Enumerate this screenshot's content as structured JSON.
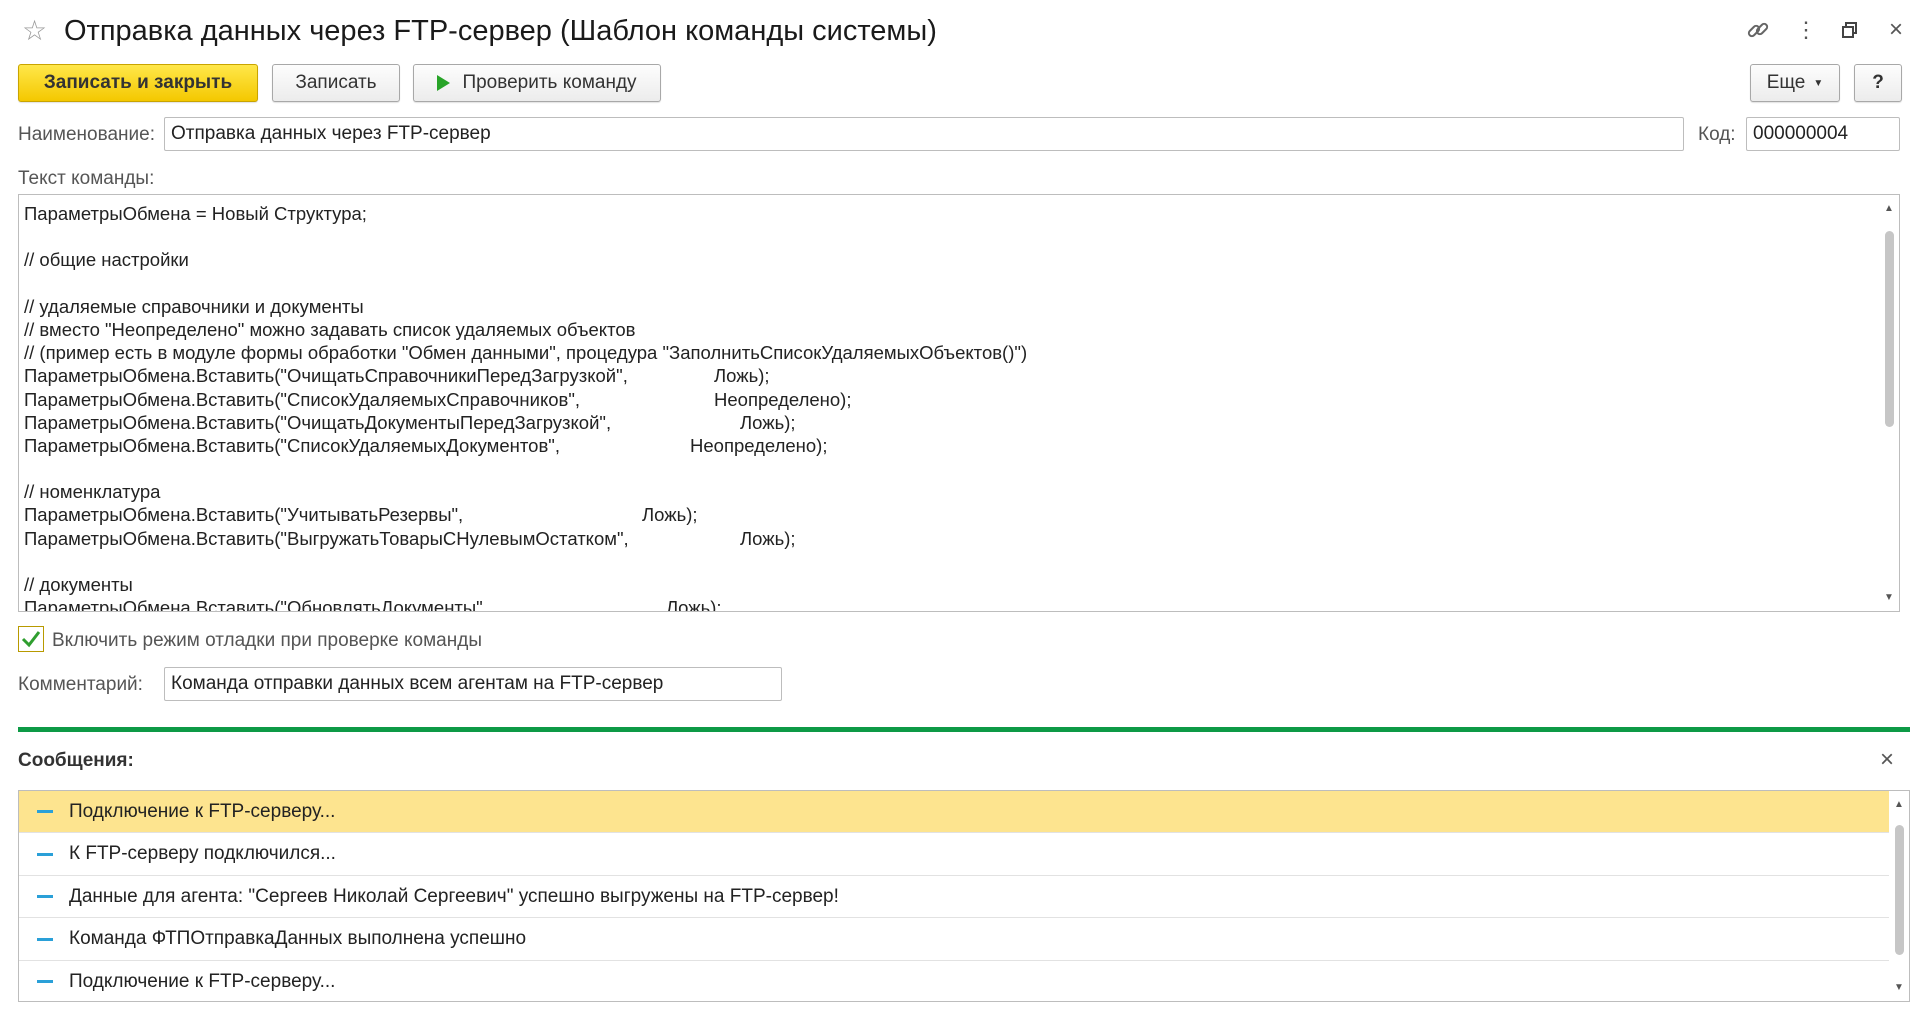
{
  "window": {
    "title": "Отправка данных через FTP-сервер (Шаблон команды системы)",
    "star_glyph": "☆",
    "menu_glyph": "⋮",
    "close_glyph": "×"
  },
  "toolbar": {
    "save_close_label": "Записать и закрыть",
    "save_label": "Записать",
    "check_label": "Проверить команду",
    "more_label": "Еще",
    "help_label": "?"
  },
  "form": {
    "name_label": "Наименование:",
    "name_value": "Отправка данных через FTP-сервер",
    "code_label": "Код:",
    "code_value": "000000004",
    "command_label": "Текст команды:",
    "command_lines": [
      {
        "a": "ПараметрыОбмена = Новый Структура;",
        "b": "",
        "pad": 0
      },
      {
        "a": "",
        "b": "",
        "pad": 0
      },
      {
        "a": "// общие настройки",
        "b": "",
        "pad": 0
      },
      {
        "a": "",
        "b": "",
        "pad": 0
      },
      {
        "a": "// удаляемые справочники и документы",
        "b": "",
        "pad": 0
      },
      {
        "a": "// вместо \"Неопределено\" можно задавать список удаляемых объектов",
        "b": "",
        "pad": 0
      },
      {
        "a": "// (пример есть в модуле формы обработки \"Обмен данными\", процедура \"ЗаполнитьСписокУдаляемыхОбъектов()\")",
        "b": "",
        "pad": 0
      },
      {
        "a": "ПараметрыОбмена.Вставить(\"ОчищатьСправочникиПередЗагрузкой\",",
        "b": "Ложь);",
        "pad": 690
      },
      {
        "a": "ПараметрыОбмена.Вставить(\"СписокУдаляемыхСправочников\",",
        "b": "Неопределено);",
        "pad": 690
      },
      {
        "a": "ПараметрыОбмена.Вставить(\"ОчищатьДокументыПередЗагрузкой\",",
        "b": "Ложь);",
        "pad": 716
      },
      {
        "a": "ПараметрыОбмена.Вставить(\"СписокУдаляемыхДокументов\",",
        "b": "Неопределено);",
        "pad": 666
      },
      {
        "a": "",
        "b": "",
        "pad": 0
      },
      {
        "a": "// номенклатура",
        "b": "",
        "pad": 0
      },
      {
        "a": "ПараметрыОбмена.Вставить(\"УчитыватьРезервы\",",
        "b": "Ложь);",
        "pad": 618
      },
      {
        "a": "ПараметрыОбмена.Вставить(\"ВыгружатьТоварыСНулевымОстатком\",",
        "b": "Ложь);",
        "pad": 716
      },
      {
        "a": "",
        "b": "",
        "pad": 0
      },
      {
        "a": "// документы",
        "b": "",
        "pad": 0
      },
      {
        "a": "ПараметрыОбмена.Вставить(\"ОбновлятьДокументы\",",
        "b": "Ложь);",
        "pad": 642
      }
    ],
    "debug_checked": true,
    "debug_label": "Включить режим отладки при проверке команды",
    "comment_label": "Комментарий:",
    "comment_value": "Команда отправки данных всем агентам на FTP-сервер"
  },
  "messages": {
    "title": "Сообщения:",
    "close_glyph": "×",
    "items": [
      {
        "text": "Подключение к FTP-серверу...",
        "active": true
      },
      {
        "text": "К FTP-серверу подключился...",
        "active": false
      },
      {
        "text": "Данные для агента: \"Сергеев Николай Сергеевич\" успешно выгружены на FTP-сервер!",
        "active": false
      },
      {
        "text": "Команда ФТПОтправкаДанных выполнена успешно",
        "active": false
      },
      {
        "text": "Подключение к FTP-серверу...",
        "active": false
      }
    ]
  },
  "colors": {
    "primary_button": "#f4c800",
    "divider": "#0d9a46",
    "active_row": "#fde48f",
    "message_marker": "#2aa0d8",
    "check_mark": "#2f9e2f"
  }
}
